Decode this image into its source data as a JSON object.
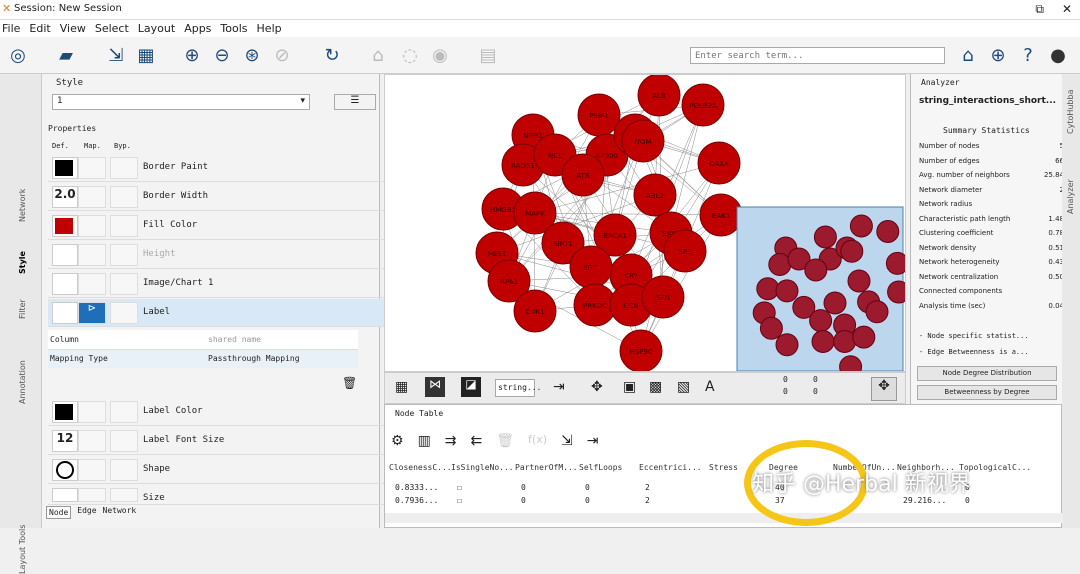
{
  "window": {
    "title": "Session: New Session"
  },
  "menu": [
    "File",
    "Edit",
    "View",
    "Select",
    "Layout",
    "Apps",
    "Tools",
    "Help"
  ],
  "search": {
    "placeholder": "Enter search term..."
  },
  "left_tabs": [
    "Network",
    "Style",
    "Filter",
    "Annotation",
    "Layout Tools"
  ],
  "right_tabs": [
    "CytoHubba",
    "Analyzer"
  ],
  "style": {
    "header": "Style",
    "selected": "1",
    "properties": "Properties",
    "cols": [
      "Def.",
      "Map.",
      "Byp."
    ],
    "rows": [
      {
        "label": "Border Paint",
        "def": ""
      },
      {
        "label": "Border Width",
        "def": "2.0"
      },
      {
        "label": "Fill Color",
        "def": ""
      },
      {
        "label": "Height",
        "def": ""
      },
      {
        "label": "Image/Chart 1",
        "def": ""
      },
      {
        "label": "Label",
        "def": ""
      },
      {
        "label": "Label Color",
        "def": ""
      },
      {
        "label": "Label Font Size",
        "def": "12"
      },
      {
        "label": "Shape",
        "def": ""
      },
      {
        "label": "Size",
        "def": ""
      }
    ],
    "column_label": "Column",
    "column_value": "shared name",
    "mapping_label": "Mapping Type",
    "mapping_value": "Passthrough Mapping"
  },
  "bottom_tabs": [
    "Node",
    "Edge",
    "Network"
  ],
  "network": {
    "nodes": [
      "ALB",
      "POLR2A",
      "NPM1",
      "PSIP1",
      "RAD51",
      "NCL",
      "EP300",
      "NOP",
      "ATR",
      "DAXX",
      "HMGB1",
      "MAPK",
      "ABL2",
      "BAK1",
      "SATB",
      "NOM",
      "HES1",
      "BRCA1",
      "SIRT1",
      "CRY",
      "NTT",
      "SP1",
      "PRKDC",
      "CCN",
      "SFN",
      "RPA1",
      "CDK1",
      "HSP90"
    ]
  },
  "netbar": {
    "name": "string...",
    "v1": "0",
    "v2": "0",
    "v3": "0",
    "v4": "0"
  },
  "nodetable": {
    "title": "Node Table",
    "columns": [
      "ClosenessC...",
      "IsSingleNo...",
      "PartnerOfM...",
      "SelfLoops",
      "Eccentrici...",
      "Stress",
      "Degree",
      "NumberOfUn...",
      "Neighborh...",
      "TopologicalC..."
    ],
    "rows": [
      [
        "0.8333...",
        "",
        "0",
        "0",
        "2",
        "",
        "40",
        "",
        "",
        "0"
      ],
      [
        "0.7936...",
        "",
        "0",
        "0",
        "2",
        "",
        "37",
        "",
        "29.216...",
        "0"
      ]
    ]
  },
  "analyzer": {
    "header": "Analyzer",
    "network": "string_interactions_short...",
    "summary": "Summary Statistics",
    "stats": [
      [
        "Number of nodes",
        "5"
      ],
      [
        "Number of edges",
        "66"
      ],
      [
        "Avg. number of neighbors",
        "25.84"
      ],
      [
        "Network diameter",
        "2"
      ],
      [
        "Network radius",
        ""
      ],
      [
        "Characteristic path length",
        "1.48"
      ],
      [
        "Clustering coefficient",
        "0.78"
      ],
      [
        "Network density",
        "0.51"
      ],
      [
        "Network heterogeneity",
        "0.43"
      ],
      [
        "Network centralization",
        "0.50"
      ],
      [
        "Connected components",
        ""
      ],
      [
        "Analysis time (sec)",
        "0.04"
      ]
    ],
    "notes": [
      "- Node specific statist...",
      "- Edge Betweenness is a..."
    ],
    "buttons": [
      "Node Degree Distribution",
      "Betweenness by Degree"
    ]
  },
  "watermark": "知乎 @Herbal 新视界",
  "colors": {
    "node": "#c00000",
    "node_small": "#9b1a2e",
    "accent": "#1e4a7a",
    "highlight": "#f5c518"
  }
}
